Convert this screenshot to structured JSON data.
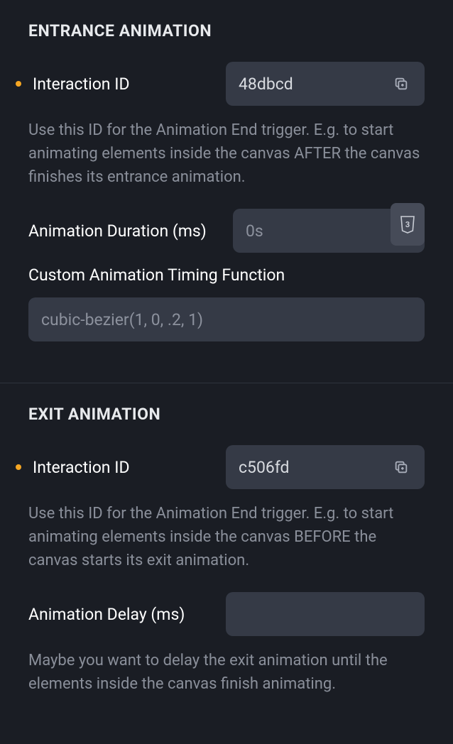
{
  "entrance": {
    "title": "ENTRANCE ANIMATION",
    "interaction_id_label": "Interaction ID",
    "interaction_id_value": "48dbcd",
    "interaction_id_help": "Use this ID for the Animation End trigger. E.g. to start animating elements inside the canvas AFTER the canvas finishes its entrance animation.",
    "duration_label": "Animation Duration (ms)",
    "duration_value": "",
    "duration_placeholder": "0s",
    "timing_label": "Custom Animation Timing Function",
    "timing_value": "",
    "timing_placeholder": "cubic-bezier(1, 0, .2, 1)"
  },
  "exit": {
    "title": "EXIT ANIMATION",
    "interaction_id_label": "Interaction ID",
    "interaction_id_value": "c506fd",
    "interaction_id_help": "Use this ID for the Animation End trigger. E.g. to start animating elements inside the canvas BEFORE the canvas starts its exit animation.",
    "delay_label": "Animation Delay (ms)",
    "delay_value": "",
    "delay_help": "Maybe you want to delay the exit animation until the elements inside the canvas finish animating."
  }
}
